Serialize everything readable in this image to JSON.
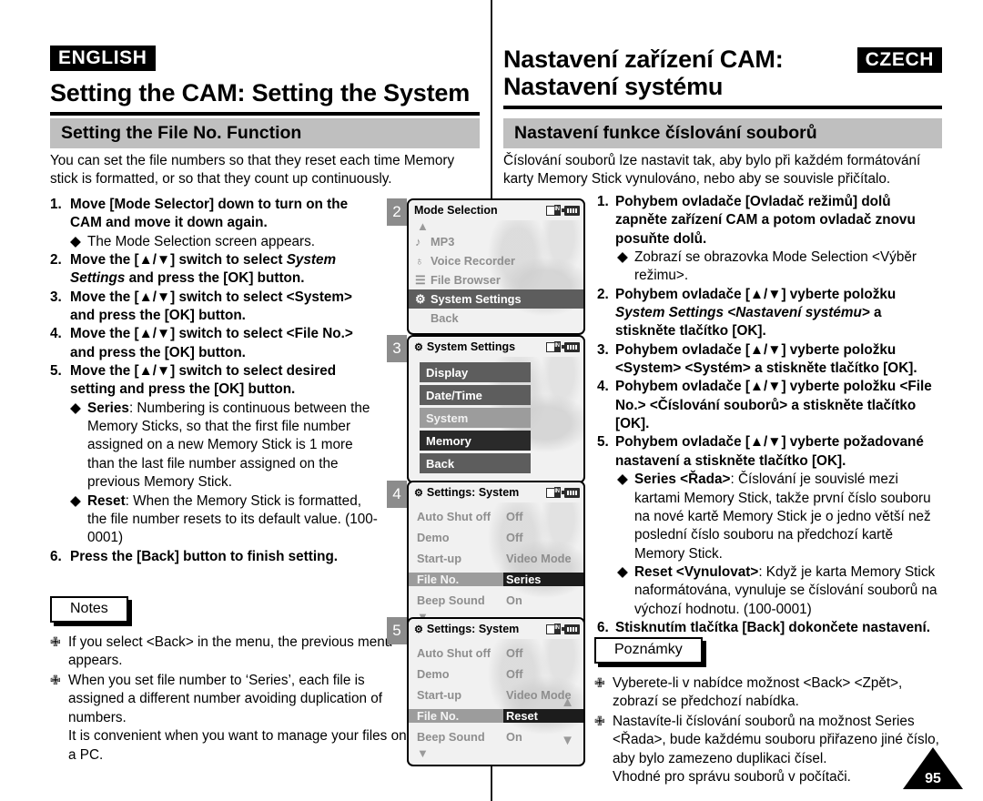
{
  "left": {
    "language_tag": "ENGLISH",
    "title": "Setting the CAM: Setting the System",
    "section_title": "Setting the File No. Function",
    "intro": "You can set the file numbers so that they reset each time Memory stick is formatted, or so that they count up continuously.",
    "steps": [
      {
        "num": "1.",
        "text": "Move [Mode Selector] down to turn on the CAM and move it down again.",
        "bullets": [
          {
            "lead": "",
            "text": "The Mode Selection screen appears."
          }
        ]
      },
      {
        "num": "2.",
        "pre": "Move the [▲/▼] switch to select ",
        "italic": "System Settings",
        "post": " and press the [OK] button.",
        "bullets": []
      },
      {
        "num": "3.",
        "text": "Move the [▲/▼] switch to select <System> and press the [OK] button.",
        "bullets": []
      },
      {
        "num": "4.",
        "text": "Move the [▲/▼] switch to select <File No.> and press the [OK] button.",
        "bullets": []
      },
      {
        "num": "5.",
        "text": "Move the [▲/▼] switch to select desired setting and press the [OK] button.",
        "bullets": [
          {
            "lead": "Series",
            "text": ": Numbering is continuous between the Memory Sticks, so that the first file number assigned on a new Memory Stick is 1 more than the last file number assigned on the previous Memory Stick."
          },
          {
            "lead": "Reset",
            "text": ": When the Memory Stick is formatted, the file number resets to its default value. (100-0001)"
          }
        ]
      },
      {
        "num": "6.",
        "text": "Press the [Back] button to finish setting.",
        "bullets": []
      }
    ],
    "notes_label": "Notes",
    "notes": [
      "If you select <Back> in the menu, the previous menu appears.",
      "When you set file number to ‘Series’, each file is assigned a different number avoiding duplication of numbers.\nIt is convenient when you want to manage your files on a PC."
    ]
  },
  "right": {
    "language_tag": "CZECH",
    "title_line1": "Nastavení zařízení CAM:",
    "title_line2": "Nastavení systému",
    "section_title": "Nastavení funkce číslování souborů",
    "intro": "Číslování souborů lze nastavit tak, aby bylo při každém formátování karty Memory Stick vynulováno, nebo aby se souvisle přičítalo.",
    "steps": [
      {
        "num": "1.",
        "text": "Pohybem ovladače [Ovladač režimů] dolů zapněte zařízení CAM a potom ovladač znovu posuňte dolů.",
        "bullets": [
          {
            "lead": "",
            "text": "Zobrazí se obrazovka Mode Selection <Výběr režimu>."
          }
        ]
      },
      {
        "num": "2.",
        "pre": "Pohybem ovladače [▲/▼] vyberte položku ",
        "italic": "System Settings <Nastavení systému>",
        "post": " a stiskněte tlačítko [OK].",
        "bullets": []
      },
      {
        "num": "3.",
        "text": "Pohybem ovladače [▲/▼] vyberte položku <System> <Systém> a stiskněte tlačítko [OK].",
        "bullets": []
      },
      {
        "num": "4.",
        "text": "Pohybem ovladače [▲/▼] vyberte položku <File No.> <Číslování souborů> a stiskněte tlačítko [OK].",
        "bullets": []
      },
      {
        "num": "5.",
        "text": "Pohybem ovladače [▲/▼] vyberte požadované nastavení a stiskněte tlačítko [OK].",
        "bullets": [
          {
            "lead": "Series <Řada>",
            "text": ": Číslování je souvislé mezi kartami Memory Stick, takže první číslo souboru na nové kartě Memory Stick je o jedno větší než poslední číslo souboru na předchozí kartě Memory Stick."
          },
          {
            "lead": "Reset <Vynulovat>",
            "text": ": Když je karta Memory Stick naformátována, vynuluje se číslování souborů na výchozí hodnotu. (100-0001)"
          }
        ]
      },
      {
        "num": "6.",
        "text": "Stisknutím tlačítka [Back] dokončete nastavení.",
        "bullets": []
      }
    ],
    "notes_label": "Poznámky",
    "notes": [
      "Vyberete-li v nabídce možnost <Back> <Zpět>, zobrazí se předchozí nabídka.",
      "Nastavíte-li číslování souborů na možnost Series <Řada>, bude každému souboru přiřazeno jiné číslo, aby bylo zamezeno duplikaci čísel.\nVhodné pro správu souborů v počítači."
    ]
  },
  "screens": [
    {
      "badge": "2",
      "title": "Mode Selection",
      "icons": [
        "memory-card-icon",
        "battery-icon"
      ],
      "type": "mode-list",
      "has_up_arrow": true,
      "rows": [
        {
          "icon": "music-note-icon",
          "label": "MP3",
          "selected": false
        },
        {
          "icon": "microphone-icon",
          "label": "Voice Recorder",
          "selected": false
        },
        {
          "icon": "document-icon",
          "label": "File Browser",
          "selected": false
        },
        {
          "icon": "system-settings-icon",
          "label": "System Settings",
          "selected": true
        },
        {
          "icon": "",
          "label": "Back",
          "selected": false
        }
      ]
    },
    {
      "badge": "3",
      "title": "System Settings",
      "title_icon": "system-settings-icon",
      "icons": [
        "memory-card-icon",
        "battery-icon"
      ],
      "type": "chip-list",
      "rows": [
        {
          "label": "Display",
          "state": "normal"
        },
        {
          "label": "Date/Time",
          "state": "normal"
        },
        {
          "label": "System",
          "state": "highlight"
        },
        {
          "label": "Memory",
          "state": "dark"
        },
        {
          "label": "Back",
          "state": "normal"
        }
      ]
    },
    {
      "badge": "4",
      "title": "Settings: System",
      "title_icon": "system-settings-icon",
      "icons": [
        "memory-card-icon",
        "battery-icon"
      ],
      "type": "kv-list",
      "has_down_arrow": true,
      "rows": [
        {
          "key": "Auto Shut off",
          "value": "Off",
          "selected": false
        },
        {
          "key": "Demo",
          "value": "Off",
          "selected": false
        },
        {
          "key": "Start-up",
          "value": "Video Mode",
          "selected": false
        },
        {
          "key": "File No.",
          "value": "Series",
          "selected": true
        },
        {
          "key": "Beep Sound",
          "value": "On",
          "selected": false
        }
      ]
    },
    {
      "badge": "5",
      "title": "Settings: System",
      "title_icon": "system-settings-icon",
      "icons": [
        "memory-card-icon",
        "battery-icon"
      ],
      "type": "kv-list",
      "has_down_arrow": true,
      "has_scroll_arrows": true,
      "rows": [
        {
          "key": "Auto Shut off",
          "value": "Off",
          "selected": false
        },
        {
          "key": "Demo",
          "value": "Off",
          "selected": false
        },
        {
          "key": "Start-up",
          "value": "Video Mode",
          "selected": false
        },
        {
          "key": "File No.",
          "value": "Reset",
          "selected": true
        },
        {
          "key": "Beep Sound",
          "value": "On",
          "selected": false
        }
      ]
    }
  ],
  "page_number": "95"
}
